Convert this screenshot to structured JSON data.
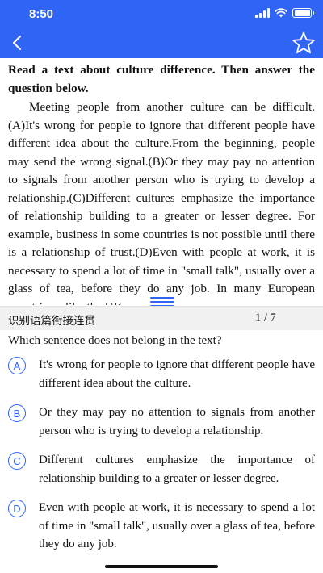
{
  "status": {
    "time": "8:50"
  },
  "colors": {
    "accent": "#2f64f5",
    "header_bg": "#f1f1f1"
  },
  "nav": {
    "back_icon": "chevron-left-icon",
    "favorite_icon": "star-outline-icon"
  },
  "passage": {
    "title": "Read a text about culture difference. Then answer the question below.",
    "body": "Meeting people from another culture can be difficult.(A)It's wrong for people to ignore that different people have different idea about the culture.From the beginning, people may send the wrong signal.(B)Or they may pay no attention to signals from another person who is trying to develop a relationship.(C)Different cultures emphasize the importance of relationship building to a greater or lesser degree. For example, business in some countries is not possible until there is a relationship of trust.(D)Even with people at work, it is necessary to spend a lot of time in \"small talk\", usually over a glass of tea, before they do any job. In many European countries—like the UK or"
  },
  "question_header": {
    "type": "识别语篇衔接连贯",
    "count": "1 / 7"
  },
  "question": {
    "stem": "Which sentence does not belong in the text?",
    "options": [
      {
        "letter": "A",
        "text": "It's wrong for people to ignore that different people have different idea about the culture."
      },
      {
        "letter": "B",
        "text": "Or they may pay no attention to signals from another person who is trying to develop a relationship."
      },
      {
        "letter": "C",
        "text": "Different cultures emphasize the importance of relationship building to a greater or lesser degree."
      },
      {
        "letter": "D",
        "text": "Even with people at work, it is necessary to spend a lot of time in \"small talk\", usually over a glass of tea, before they do any job."
      }
    ]
  }
}
